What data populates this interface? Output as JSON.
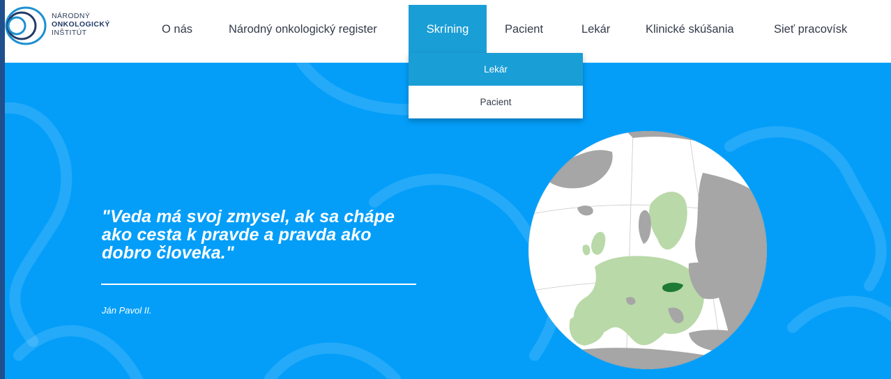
{
  "header": {
    "logo": {
      "line1": "NÁRODNÝ",
      "line2": "ONKOLOGICKÝ",
      "line3": "INŠTITÚT"
    },
    "nav": [
      {
        "label": "O nás"
      },
      {
        "label": "Národný onkologický register"
      },
      {
        "label": "Skríning",
        "active": true
      },
      {
        "label": "Pacient"
      },
      {
        "label": "Lekár"
      },
      {
        "label": "Klinické skúšania"
      },
      {
        "label": "Sieť pracovísk"
      }
    ]
  },
  "dropdown": {
    "items": [
      {
        "label": "Lekár",
        "highlighted": true
      },
      {
        "label": "Pacient"
      }
    ]
  },
  "hero": {
    "quote": "\"Veda má svoj zmysel, ak sa chápe ako cesta k pravde a pravda ako dobro človeka.\"",
    "author": "Ján Pavol II."
  },
  "colors": {
    "hero_background": "#049ef9",
    "accent": "#1a9ed6",
    "edge_strip": "#1f4f8c",
    "map_highlight": "#1f7a33",
    "eu_land": "#b9d9a8",
    "other_land": "#a6a6a6"
  }
}
